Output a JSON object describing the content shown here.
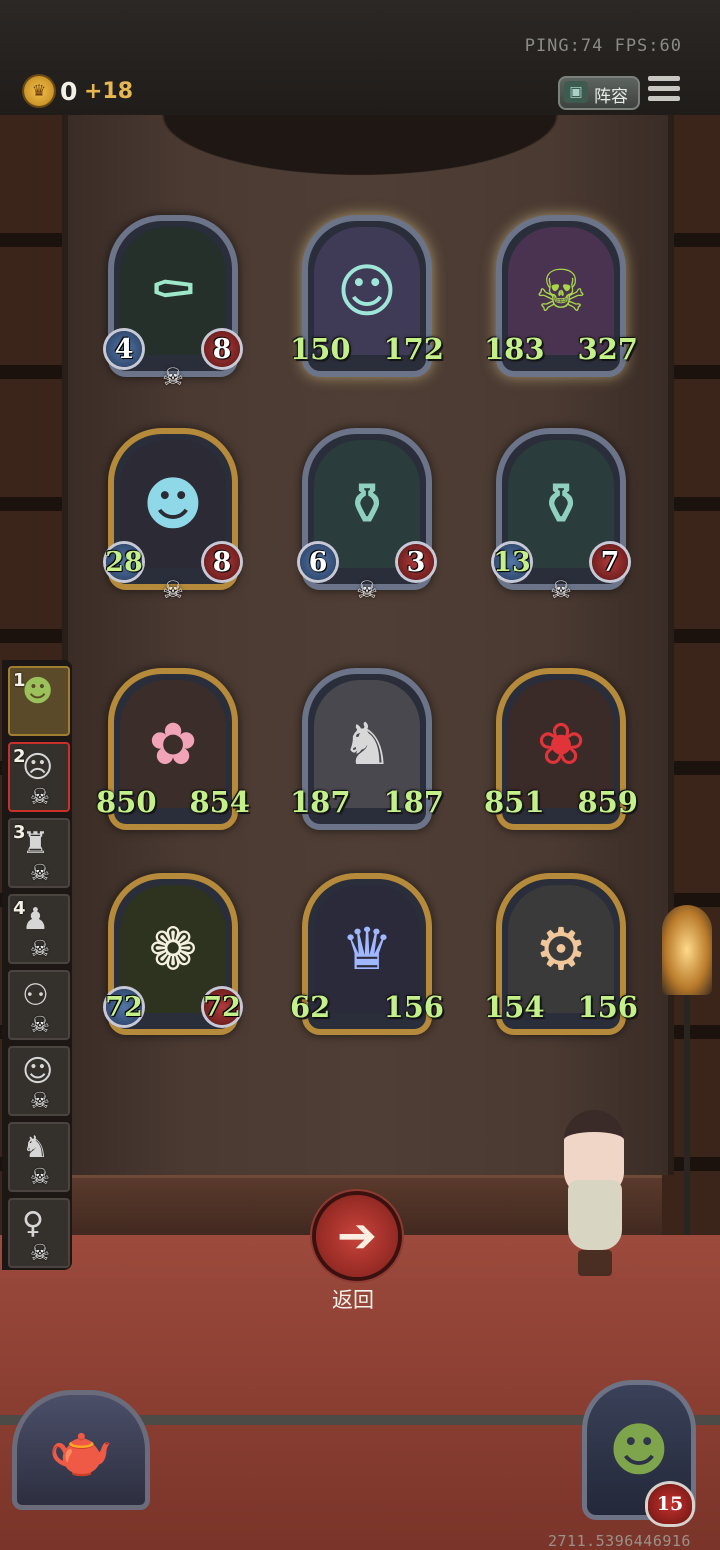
{
  "top_bar": {
    "ping": "PING:74  FPS:60",
    "gold": "0",
    "income": "+18",
    "lineup_label": "阵容"
  },
  "board": {
    "rows": [
      [
        {
          "attack": "4",
          "health": "8",
          "frame": "silver",
          "skull": true,
          "icon": "shadow-coffin-icon"
        },
        {
          "attack": "150",
          "health": "172",
          "frame": "silver",
          "skull": false,
          "icon": "ghost-cop-icon"
        },
        {
          "attack": "183",
          "health": "327",
          "frame": "silver",
          "skull": false,
          "icon": "pumpkin-monster-icon"
        }
      ],
      [
        {
          "attack": "28",
          "health": "8",
          "frame": "gold",
          "skull": true,
          "icon": "ghost-imp-icon"
        },
        {
          "attack": "6",
          "health": "3",
          "frame": "silver",
          "skull": true,
          "icon": "bottle-man-icon"
        },
        {
          "attack": "13",
          "health": "7",
          "frame": "silver",
          "skull": true,
          "icon": "bottle-man-icon"
        }
      ],
      [
        {
          "attack": "850",
          "health": "854",
          "frame": "gold",
          "skull": false,
          "icon": "flower-fairy-icon"
        },
        {
          "attack": "187",
          "health": "187",
          "frame": "silver",
          "skull": false,
          "icon": "stone-dragon-icon"
        },
        {
          "attack": "851",
          "health": "859",
          "frame": "gold",
          "skull": false,
          "icon": "rose-girl-icon"
        }
      ],
      [
        {
          "attack": "72",
          "health": "72",
          "frame": "gold",
          "skull": false,
          "icon": "daisy-icon"
        },
        {
          "attack": "62",
          "health": "156",
          "frame": "gold",
          "skull": false,
          "icon": "elf-queen-icon"
        },
        {
          "attack": "154",
          "health": "156",
          "frame": "gold",
          "skull": false,
          "icon": "engineer-icon"
        }
      ]
    ]
  },
  "roster": {
    "slots": [
      {
        "number": "1",
        "icon": "goblin-icon",
        "skull": false
      },
      {
        "number": "2",
        "icon": "robot-icon",
        "skull": true
      },
      {
        "number": "3",
        "icon": "warrior-icon",
        "skull": true
      },
      {
        "number": "4",
        "icon": "mouse-icon",
        "skull": true
      },
      {
        "number": "",
        "icon": "goggles-icon",
        "skull": true
      },
      {
        "number": "",
        "icon": "old-man-icon",
        "skull": true
      },
      {
        "number": "",
        "icon": "cat-icon",
        "skull": true
      },
      {
        "number": "",
        "icon": "lady-icon",
        "skull": true
      }
    ]
  },
  "back_button": {
    "label": "返回"
  },
  "player": {
    "health": "15"
  },
  "footer": {
    "coords": "2711.5396446916"
  }
}
